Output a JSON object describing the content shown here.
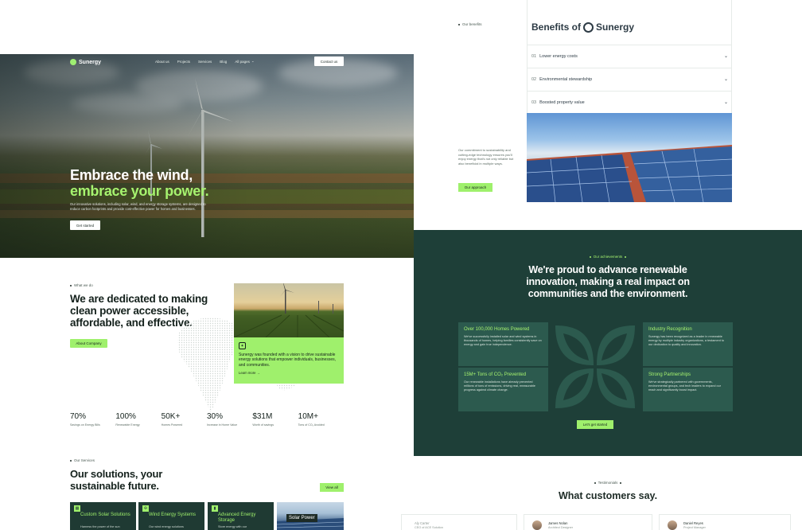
{
  "nav": {
    "brand": "Sunergy",
    "links": [
      "About us",
      "Projects",
      "Services",
      "Blog",
      "All pages"
    ],
    "contact_label": "Contact us"
  },
  "hero": {
    "title_line1": "Embrace the wind,",
    "title_line2": "embrace your power.",
    "description": "Our innovative solutions, including solar, wind, and energy storage systems, are designed to reduce carbon footprints and provide cost-effective power for homes and businesses.",
    "cta_label": "Get started"
  },
  "about": {
    "tag": "What we do",
    "title": "We are dedicated to making clean power accessible, affordable, and effective.",
    "button_label": "About Company",
    "card_text": "Sunergy was founded with a vision to drive sustainable energy solutions that empower individuals, businesses, and communities.",
    "card_link": "Learn more →",
    "stats": [
      {
        "value": "70%",
        "label": "Savings on Energy Bills"
      },
      {
        "value": "100%",
        "label": "Renewable Energy"
      },
      {
        "value": "50K+",
        "label": "Homes Powered"
      },
      {
        "value": "30%",
        "label": "Increase in Home Value"
      },
      {
        "value": "$31M",
        "label": "Worth of savings"
      },
      {
        "value": "10M+",
        "label": "Tons of CO₂ Avoided"
      }
    ]
  },
  "services": {
    "tag": "Our Services",
    "title_line1": "Our solutions, your",
    "title_line2": "sustainable future.",
    "view_all_label": "View all",
    "cards": [
      {
        "title": "Custom Solar Solutions",
        "desc": "Harness the power of the sun"
      },
      {
        "title": "Wind Energy Systems",
        "desc": "Our wind energy solutions"
      },
      {
        "title": "Advanced Energy Storage",
        "desc": "Store energy with our"
      }
    ],
    "photo_label": "Solar Power"
  },
  "benefits": {
    "tag": "Our benefits",
    "title": "Benefits of",
    "brand": "Sunergy",
    "items": [
      {
        "num": "01",
        "label": "Lower energy costs"
      },
      {
        "num": "02",
        "label": "Environmental stewardship"
      },
      {
        "num": "03",
        "label": "Boosted property value"
      }
    ],
    "description": "Our commitment to sustainability and cutting-edge technology ensures you'll enjoy energy that's not only reliable but also beneficial in multiple ways.",
    "button_label": "Our approach"
  },
  "achievements": {
    "tag": "Our achievements",
    "title": "We're proud to advance renewable innovation, making a real impact on communities and the environment.",
    "cards": [
      {
        "title": "Over 100,000 Homes Powered",
        "desc": "We've successfully installed solar and wind systems in thousands of homes, helping families consistently save on energy and gain true independence."
      },
      {
        "title": "15M+ Tons of CO₂ Prevented",
        "desc": "Our renewable installations have already prevented millions of tons of emissions, driving real, measurable progress against climate change."
      },
      {
        "title": "Industry Recognition",
        "desc": "Sunergy has been recognized as a leader in renewable energy by multiple industry organizations, a testament to our dedication to quality and innovation."
      },
      {
        "title": "Strong Partnerships",
        "desc": "We've strategically partnered with governments, environmental groups, and tech leaders to expand our reach and significantly boost impact."
      }
    ],
    "button_label": "Let's get started"
  },
  "testimonials": {
    "tag": "Testimonials",
    "title": "What customers say.",
    "people": [
      {
        "name": "Aly Carter",
        "role": "CEO of ACE Solution"
      },
      {
        "name": "James Nolan",
        "role": "Architect Designer"
      },
      {
        "name": "Daniel Reyes",
        "role": "Project Manager"
      }
    ]
  },
  "colors": {
    "accent": "#9ff06c",
    "dark_green": "#1e3f38",
    "card_green": "#2c5a4e",
    "text": "#14211c"
  }
}
